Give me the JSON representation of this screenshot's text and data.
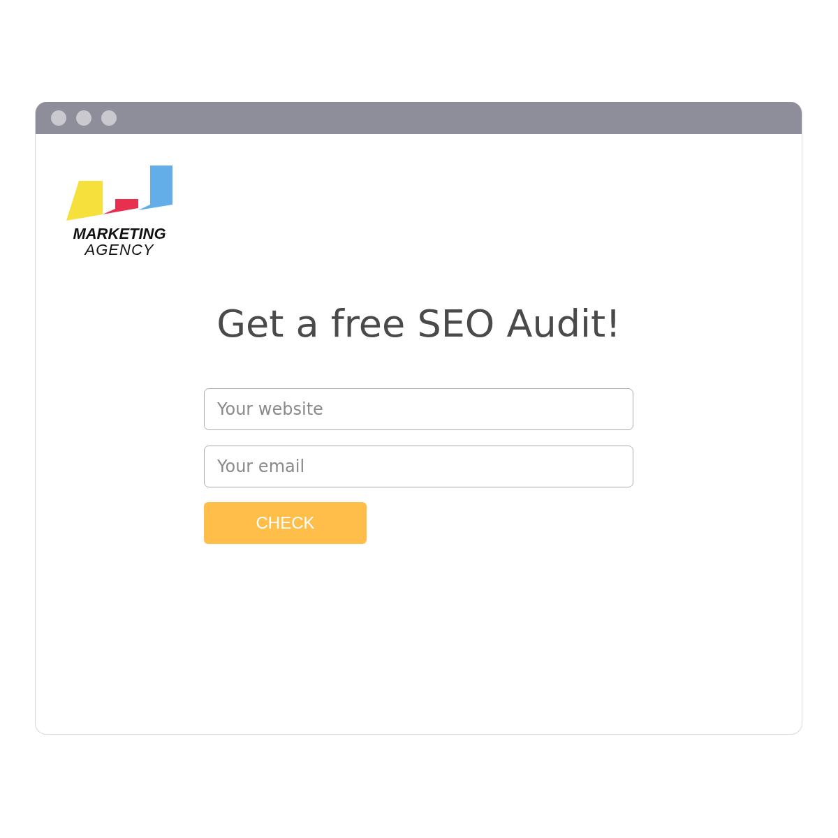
{
  "logo": {
    "line1": "MARKETING",
    "line2": "AGENCY"
  },
  "heading": "Get a free SEO Audit!",
  "fields": [
    {
      "placeholder": "Your website"
    },
    {
      "placeholder": "Your email"
    }
  ],
  "button": {
    "label": "CHECK"
  }
}
